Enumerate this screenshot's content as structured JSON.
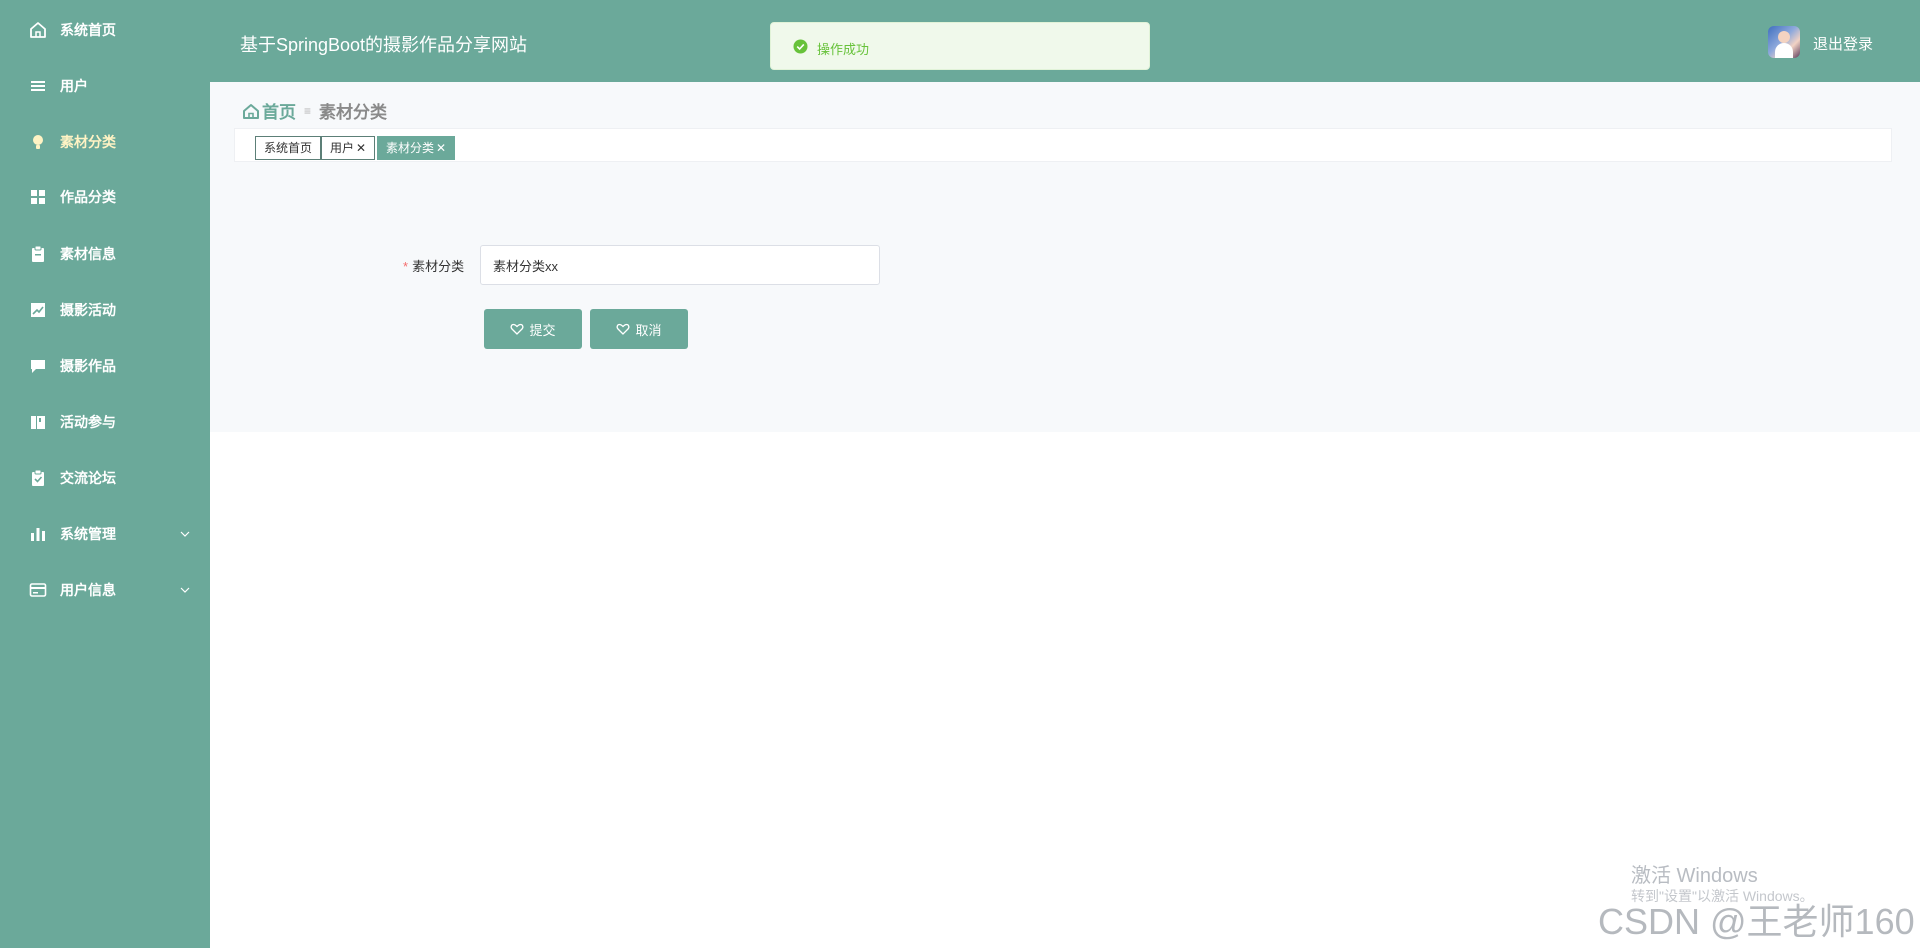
{
  "sidebar": {
    "items": [
      {
        "label": "系统首页",
        "icon": "home-icon"
      },
      {
        "label": "用户",
        "icon": "list-icon"
      },
      {
        "label": "素材分类",
        "icon": "bulb-icon"
      },
      {
        "label": "作品分类",
        "icon": "grid-icon"
      },
      {
        "label": "素材信息",
        "icon": "clipboard-icon"
      },
      {
        "label": "摄影活动",
        "icon": "chart-icon"
      },
      {
        "label": "摄影作品",
        "icon": "message-icon"
      },
      {
        "label": "活动参与",
        "icon": "book-icon"
      },
      {
        "label": "交流论坛",
        "icon": "clipboard-check-icon"
      },
      {
        "label": "系统管理",
        "icon": "bar-chart-icon"
      },
      {
        "label": "用户信息",
        "icon": "card-icon"
      }
    ],
    "active_index": 2
  },
  "header": {
    "title": "基于SpringBoot的摄影作品分享网站",
    "logout_label": "退出登录"
  },
  "toast": {
    "message": "操作成功"
  },
  "breadcrumb": {
    "home": "首页",
    "separator": "≡",
    "current": "素材分类"
  },
  "tags": [
    {
      "label": "系统首页",
      "closable": false
    },
    {
      "label": "用户",
      "closable": true
    },
    {
      "label": "素材分类",
      "closable": true
    }
  ],
  "tag_close": "✕",
  "form": {
    "field_label": "素材分类",
    "required_mark": "*",
    "field_value": "素材分类xx",
    "submit_label": "提交",
    "cancel_label": "取消"
  },
  "watermarks": {
    "windows_title": "激活 Windows",
    "windows_sub": "转到\"设置\"以激活 Windows。",
    "csdn": "CSDN @王老师160"
  },
  "colors": {
    "primary": "#6ba99a",
    "active_menu": "#fff3c4",
    "success": "#67c23a"
  }
}
